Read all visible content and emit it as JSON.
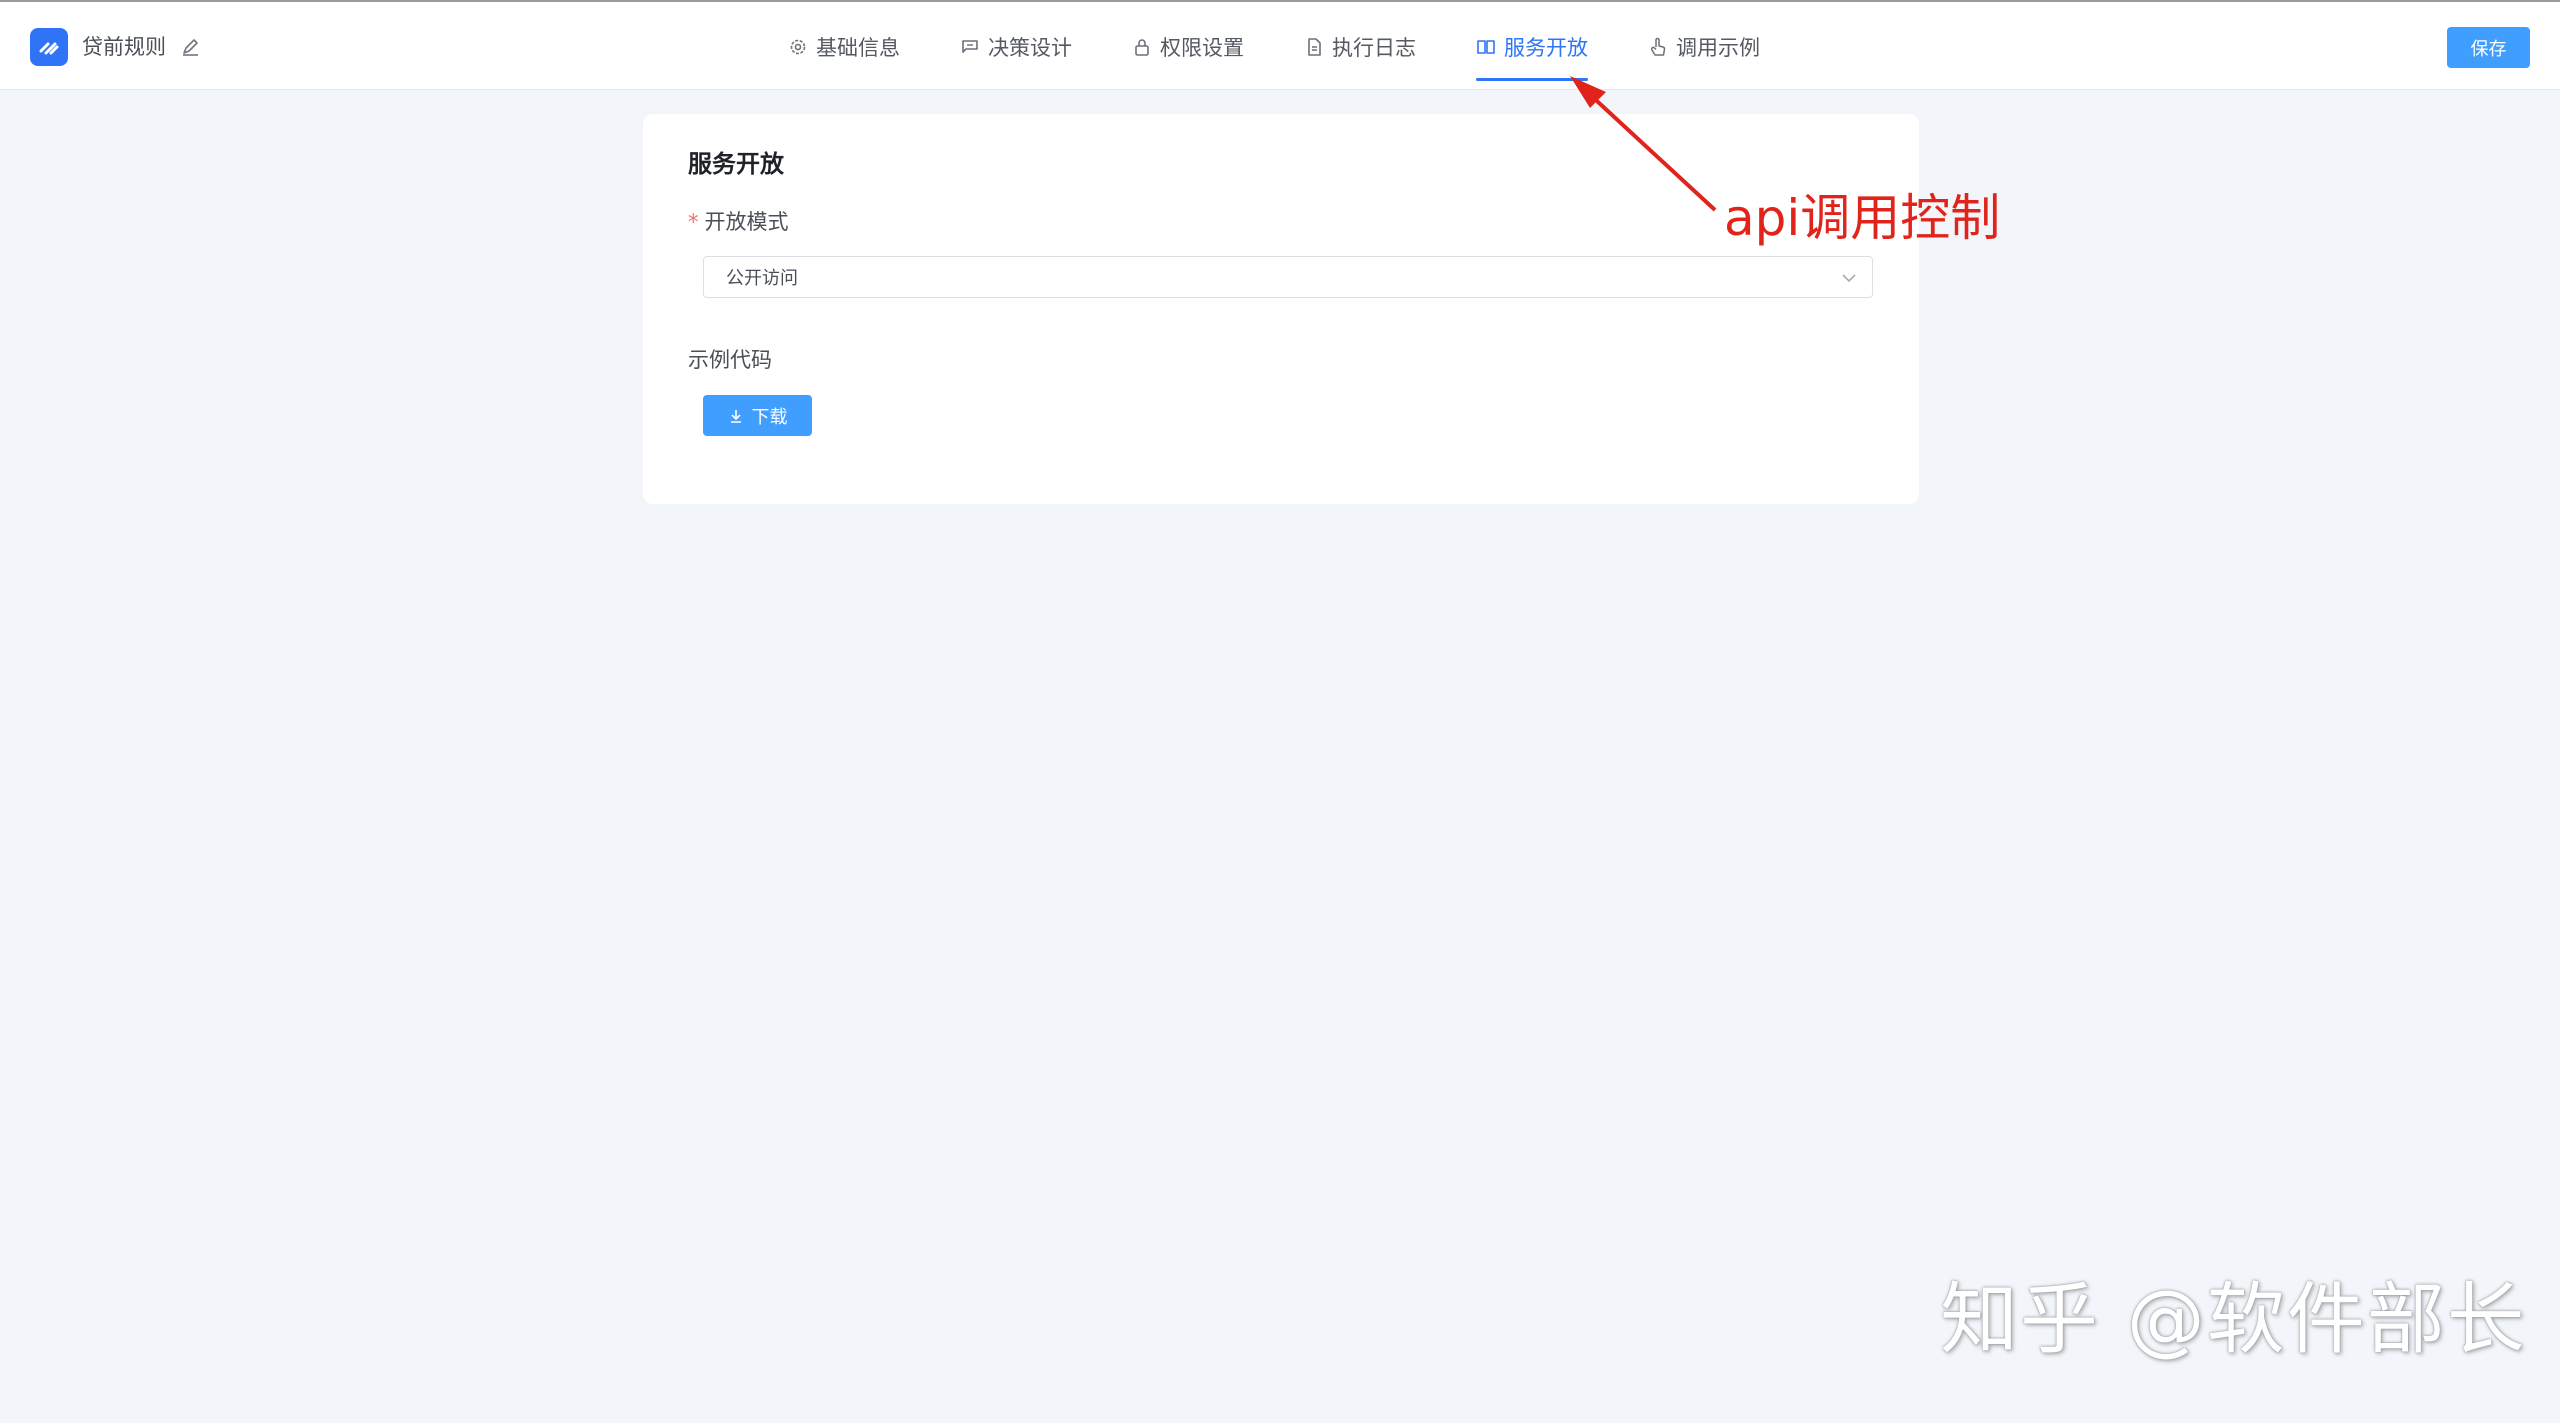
{
  "header": {
    "app_title": "贷前规则",
    "save_label": "保存",
    "tabs": [
      {
        "label": "基础信息",
        "icon": "gear-icon"
      },
      {
        "label": "决策设计",
        "icon": "flag-icon"
      },
      {
        "label": "权限设置",
        "icon": "lock-icon"
      },
      {
        "label": "执行日志",
        "icon": "document-icon"
      },
      {
        "label": "服务开放",
        "icon": "book-icon",
        "active": true
      },
      {
        "label": "调用示例",
        "icon": "hand-pointer-icon"
      }
    ]
  },
  "card": {
    "title": "服务开放",
    "mode_label": "开放模式",
    "mode_value": "公开访问",
    "code_label": "示例代码",
    "download_label": "下载"
  },
  "annotation": {
    "text": "api调用控制",
    "color": "#e0241b"
  },
  "watermark": {
    "text": "知乎 @软件部长"
  },
  "colors": {
    "accent": "#2f74f6",
    "button": "#409eff",
    "background": "#f2f5f9",
    "required": "#f56c6c"
  }
}
